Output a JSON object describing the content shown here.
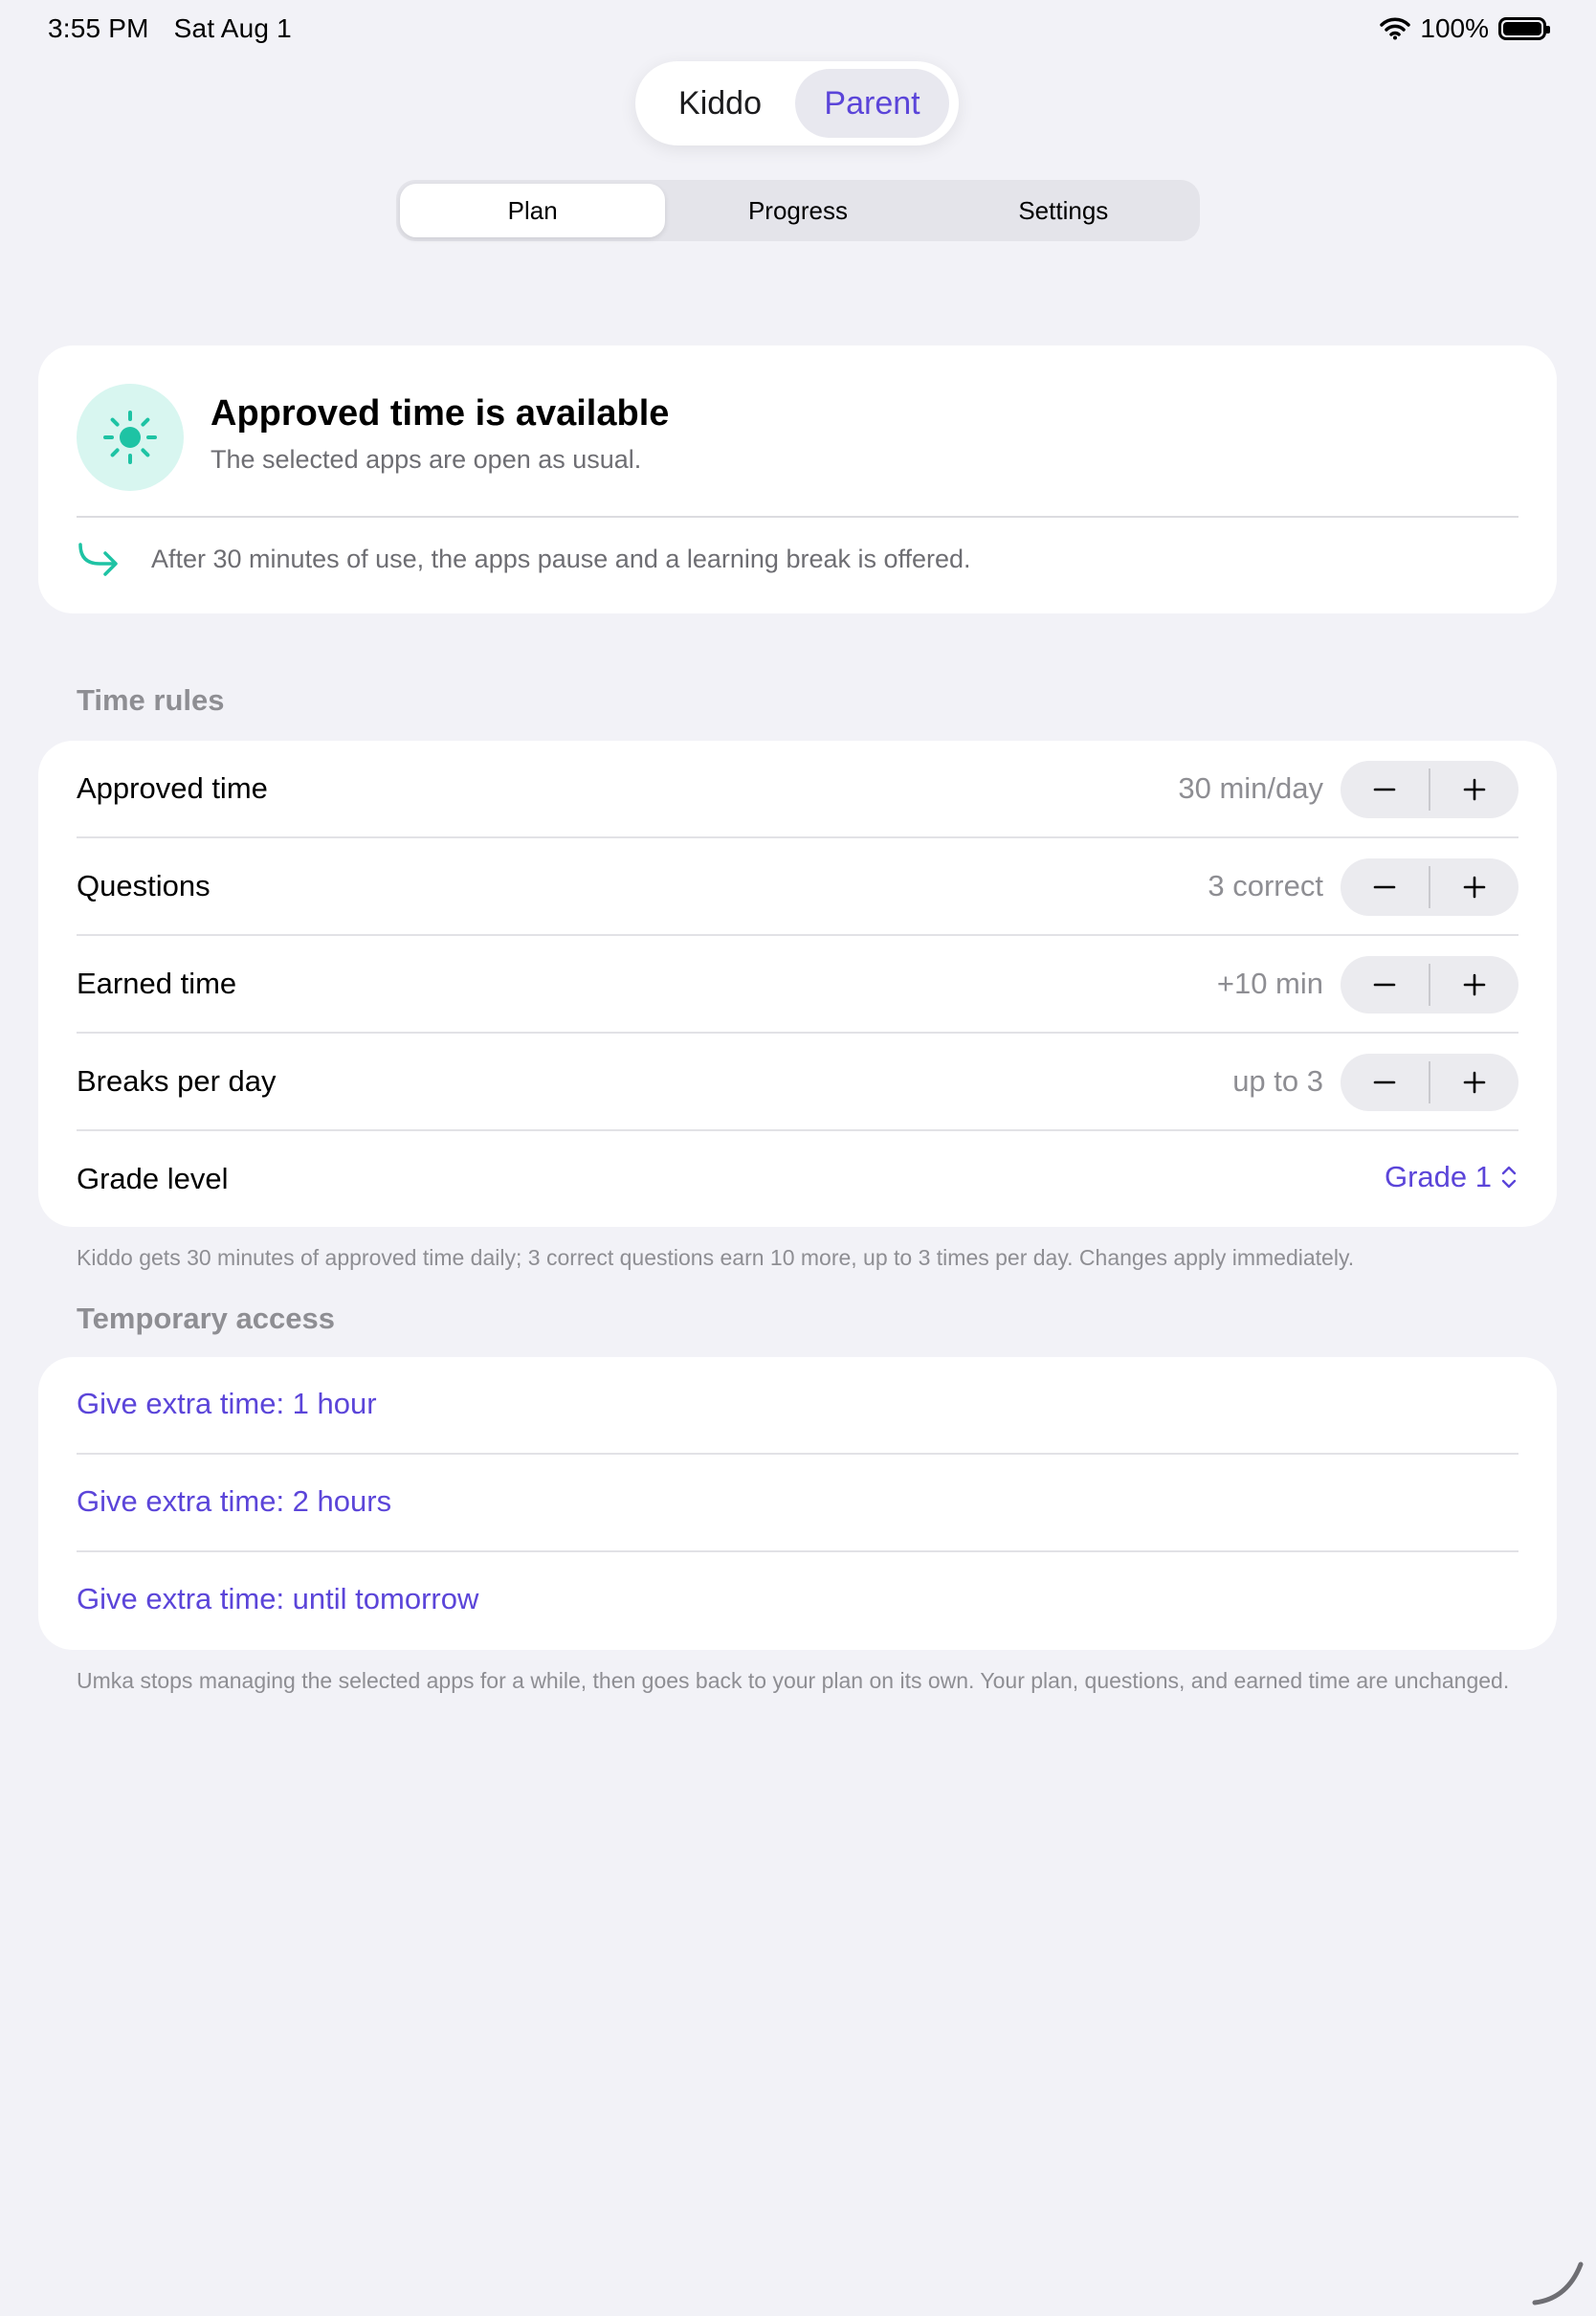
{
  "status_bar": {
    "time": "3:55 PM",
    "date": "Sat Aug 1",
    "battery": "100%"
  },
  "mode_switch": {
    "kiddo_label": "Kiddo",
    "parent_label": "Parent",
    "selected": "Parent"
  },
  "tabs": [
    {
      "label": "Plan",
      "active": true
    },
    {
      "label": "Progress",
      "active": false
    },
    {
      "label": "Settings",
      "active": false
    }
  ],
  "status_card": {
    "icon": "sun-icon",
    "title": "Approved time is available",
    "subtitle": "The selected apps are open as usual.",
    "note_icon": "arrow-turn-right-icon",
    "note": "After 30 minutes of use, the apps pause and a learning break is offered."
  },
  "time_rules": {
    "section_title": "Time rules",
    "rows": [
      {
        "label": "Approved time",
        "value": "30 min/day"
      },
      {
        "label": "Questions",
        "value": "3 correct"
      },
      {
        "label": "Earned time",
        "value": "+10 min"
      },
      {
        "label": "Breaks per day",
        "value": "up to 3"
      }
    ],
    "grade": {
      "label": "Grade level",
      "value": "Grade 1"
    },
    "footnote": "Kiddo gets 30 minutes of approved time daily; 3 correct questions earn 10 more, up to 3 times per day. Changes apply immediately."
  },
  "temporary_access": {
    "section_title": "Temporary access",
    "links": [
      {
        "label": "Give extra time: 1 hour"
      },
      {
        "label": "Give extra time: 2 hours"
      },
      {
        "label": "Give extra time: until tomorrow"
      }
    ],
    "footnote": "Umka stops managing the selected apps for a while, then goes back to your plan on its own. Your plan, questions, and earned time are unchanged."
  },
  "colors": {
    "accent": "#5b45d9",
    "teal": "#1ec3a4",
    "background": "#f2f2f7"
  }
}
